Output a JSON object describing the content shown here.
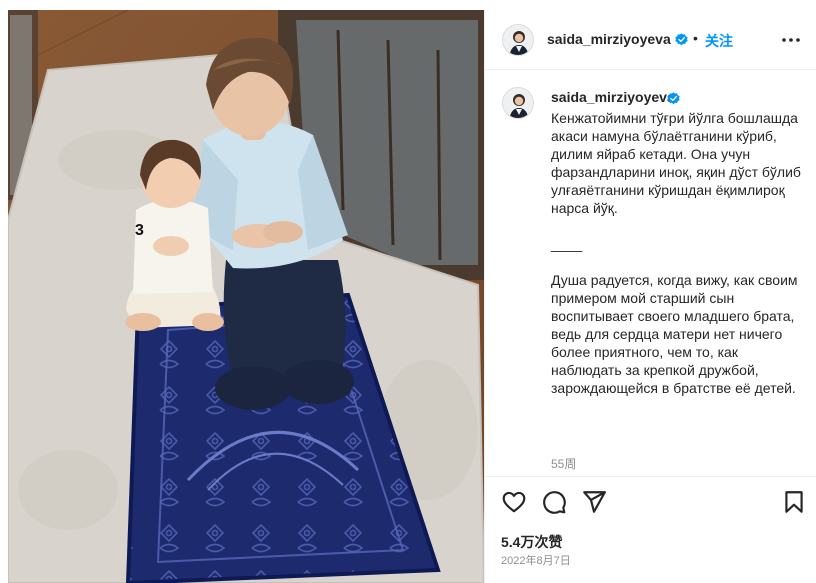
{
  "post": {
    "author": {
      "username": "saida_mirziyoyeva",
      "verified": true,
      "avatar_icon": "profile-avatar"
    },
    "header": {
      "separator": "•",
      "follow_label": "关注",
      "more_icon": "more-horizontal-icon"
    },
    "caption": {
      "text": "Кенжатойимни тўғри йўлга бошлашда акаси намуна бўлаётганини кўриб, дилим яйраб кетади. Она учун фарзандларини иноқ, яқин дўст бўлиб улғаяётганини кўришдан ёқимлироқ нарса йўқ.\n\n____\n\nДуша радуется, когда вижу, как своим примером мой старший сын воспитывает своего младшего брата, ведь для сердца матери нет ничего более приятного, чем то, как наблюдать за крепкой дружбой, зарождающейся в братстве её детей.",
      "time_ago": "55周"
    },
    "actions": {
      "like_icon": "heart-icon",
      "comment_icon": "comment-icon",
      "share_icon": "paper-plane-icon",
      "save_icon": "bookmark-icon"
    },
    "likes": "5.4万次赞",
    "date": "2022年8月7日",
    "photo": {
      "jersey_number": "3"
    },
    "colors": {
      "follow_blue": "#0095f6",
      "verified_blue": "#0095f6",
      "muted_text": "#8e8e8e",
      "border": "#efefef",
      "prayer_rug": "#1d2a6e"
    }
  }
}
